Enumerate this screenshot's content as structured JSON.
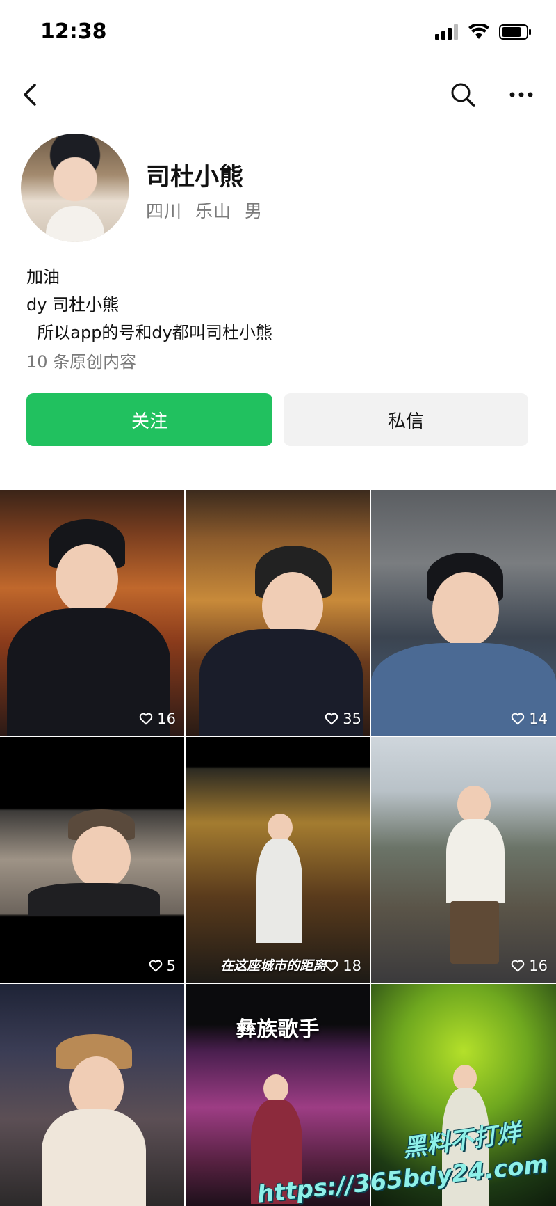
{
  "status_bar": {
    "time": "12:38"
  },
  "profile": {
    "name": "司杜小熊",
    "meta": [
      "四川",
      "乐山",
      "男"
    ],
    "bio_lines": [
      "加油",
      "dy 司杜小熊",
      "  所以app的号和dy都叫司杜小熊"
    ],
    "original_count": "10 条原创内容"
  },
  "actions": {
    "follow_label": "关注",
    "message_label": "私信"
  },
  "grid": {
    "tiles": [
      {
        "likes": "16"
      },
      {
        "likes": "35"
      },
      {
        "likes": "14"
      },
      {
        "likes": "5"
      },
      {
        "likes": "18",
        "caption": "在这座城市的距离"
      },
      {
        "likes": "16"
      },
      {},
      {
        "title": "彝族歌手"
      },
      {}
    ]
  },
  "watermark": {
    "line1": "黑料不打烊",
    "line2": "https://365bdy24.com"
  },
  "colors": {
    "follow": "#21c15f",
    "message_bg": "#f2f2f2",
    "meta_gray": "#7a7a7a"
  }
}
